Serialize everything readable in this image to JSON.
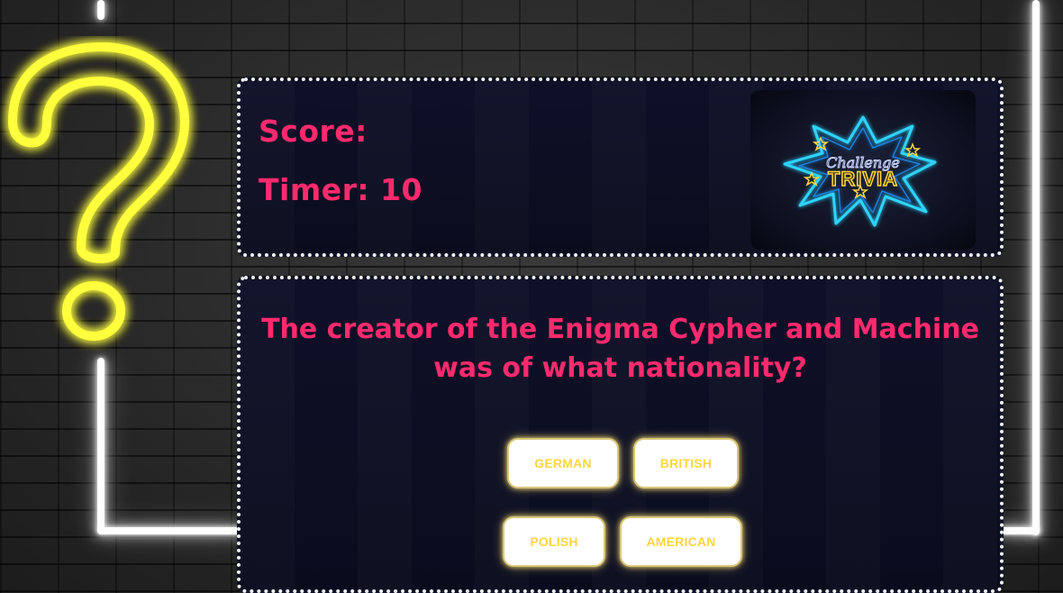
{
  "stats": {
    "score_label": "Score:",
    "timer_label": "Timer: 10"
  },
  "logo": {
    "script_text": "Challenge",
    "title_text": "TRIVIA"
  },
  "question": {
    "text": "The creator of the Enigma Cypher and Machine was of what nationality?"
  },
  "answers": [
    {
      "label": "GERMAN"
    },
    {
      "label": "BRITISH"
    },
    {
      "label": "POLISH"
    },
    {
      "label": "AMERICAN"
    }
  ],
  "colors": {
    "accent_pink": "#ff2a6d",
    "answer_text_yellow": "#ffd541",
    "neon_yellow": "#ffff3c",
    "neon_blue": "#2fd4ff",
    "panel_bg": "#0e1028"
  },
  "icons": {
    "question_mark": "neon-question-mark-icon",
    "star": "star-icon"
  }
}
